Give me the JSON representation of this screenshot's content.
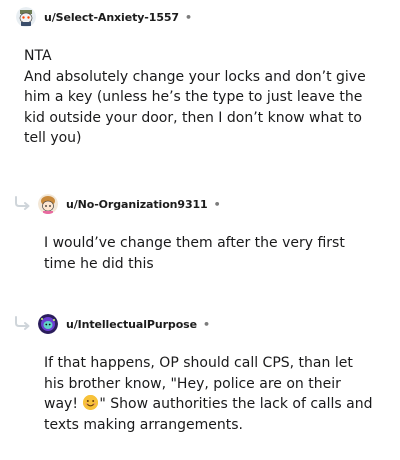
{
  "comments": [
    {
      "username": "u/Select-Anxiety-1557",
      "separator": "•",
      "avatar_icon": "mascot-avatar-icon",
      "paragraphs": [
        "NTA",
        "And absolutely change your locks and don’t give him a key (unless he’s the type to just leave the kid outside your door, then I don’t know what to tell you)"
      ]
    },
    {
      "username": "u/No-Organization9311",
      "separator": "•",
      "avatar_icon": "mascot-avatar-icon",
      "paragraphs": [
        "I would’ve change them after the very first time he did this"
      ]
    },
    {
      "username": "u/IntellectualPurpose",
      "separator": "•",
      "avatar_icon": "mascot-avatar-icon",
      "text_before_emoji": "If that happens, OP should call CPS, than let his brother know, \"Hey, police are on their way! ",
      "emoji_icon": "smiling-face-emoji-icon",
      "text_after_emoji": "\" Show authorities the lack of calls and texts making arrangements."
    }
  ],
  "colors": {
    "text": "#1a1a1b",
    "meta": "#7c7c7c",
    "thread_line": "#cfd5da"
  }
}
